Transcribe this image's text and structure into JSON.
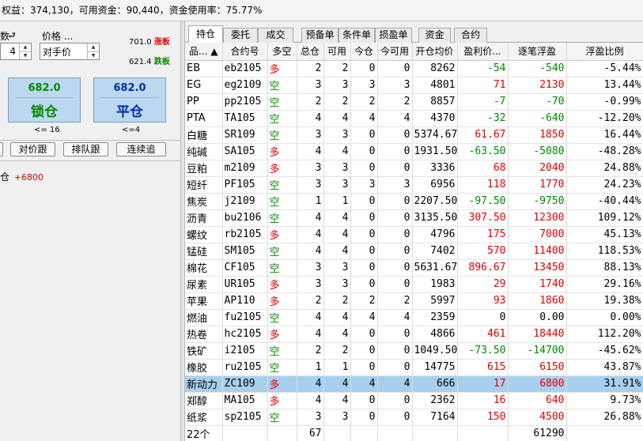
{
  "account_bar": {
    "text": "权益：374,130，可用资金：90,440，资金使用率：75.77%"
  },
  "order_panel": {
    "qty_label_fragment": "数",
    "qty_value": "4",
    "price_label": "价格 ...",
    "price_value": "对手价",
    "limit_up_value": "701.0",
    "limit_up_label": "涨板",
    "limit_down_value": "621.4",
    "limit_down_label": "跌板",
    "lock_button": {
      "price": "682.0",
      "label": "锁仓"
    },
    "close_button": {
      "price": "682.0",
      "label": "平仓"
    },
    "lock_qty_note": "<= 16",
    "close_qty_note": "<=4",
    "buttons": [
      "对价跟",
      "排队跟",
      "连续追"
    ],
    "status_prefix": "多仓",
    "status_value": "+6800"
  },
  "tabs": [
    "持仓",
    "委托",
    "成交",
    "预备单",
    "条件单",
    "损盈单",
    "资金",
    "合约"
  ],
  "active_tab": "持仓",
  "columns": [
    "品... ▲",
    "合约号",
    "多空",
    "总仓",
    "可用",
    "今仓",
    "今可用",
    "开仓均价",
    "盈利价...",
    "逐笔浮盈",
    "浮盈比例"
  ],
  "rows": [
    {
      "name": "EB",
      "code": "eb2105",
      "dir": "多",
      "total": "2",
      "avail": "2",
      "today": "0",
      "today_avail": "0",
      "avg": "8262",
      "pnl_price": "-54",
      "float_pnl": "-540",
      "ratio": "-5.44%"
    },
    {
      "name": "EG",
      "code": "eg2109",
      "dir": "空",
      "total": "3",
      "avail": "3",
      "today": "3",
      "today_avail": "3",
      "avg": "4801",
      "pnl_price": "71",
      "float_pnl": "2130",
      "ratio": "13.44%"
    },
    {
      "name": "PP",
      "code": "pp2105",
      "dir": "空",
      "total": "2",
      "avail": "2",
      "today": "2",
      "today_avail": "2",
      "avg": "8857",
      "pnl_price": "-7",
      "float_pnl": "-70",
      "ratio": "-0.99%"
    },
    {
      "name": "PTA",
      "code": "TA105",
      "dir": "空",
      "total": "4",
      "avail": "4",
      "today": "4",
      "today_avail": "4",
      "avg": "4370",
      "pnl_price": "-32",
      "float_pnl": "-640",
      "ratio": "-12.20%"
    },
    {
      "name": "白糖",
      "code": "SR109",
      "dir": "空",
      "total": "3",
      "avail": "3",
      "today": "0",
      "today_avail": "0",
      "avg": "5374.67",
      "pnl_price": "61.67",
      "float_pnl": "1850",
      "ratio": "16.44%"
    },
    {
      "name": "纯碱",
      "code": "SA105",
      "dir": "多",
      "total": "4",
      "avail": "4",
      "today": "0",
      "today_avail": "0",
      "avg": "1931.50",
      "pnl_price": "-63.50",
      "float_pnl": "-5080",
      "ratio": "-48.28%"
    },
    {
      "name": "豆粕",
      "code": "m2109",
      "dir": "多",
      "total": "3",
      "avail": "3",
      "today": "0",
      "today_avail": "0",
      "avg": "3336",
      "pnl_price": "68",
      "float_pnl": "2040",
      "ratio": "24.88%"
    },
    {
      "name": "短纤",
      "code": "PF105",
      "dir": "空",
      "total": "3",
      "avail": "3",
      "today": "3",
      "today_avail": "3",
      "avg": "6956",
      "pnl_price": "118",
      "float_pnl": "1770",
      "ratio": "24.23%"
    },
    {
      "name": "焦炭",
      "code": "j2109",
      "dir": "空",
      "total": "1",
      "avail": "1",
      "today": "0",
      "today_avail": "0",
      "avg": "2207.50",
      "pnl_price": "-97.50",
      "float_pnl": "-9750",
      "ratio": "-40.44%"
    },
    {
      "name": "沥青",
      "code": "bu2106",
      "dir": "空",
      "total": "4",
      "avail": "4",
      "today": "0",
      "today_avail": "0",
      "avg": "3135.50",
      "pnl_price": "307.50",
      "float_pnl": "12300",
      "ratio": "109.12%"
    },
    {
      "name": "螺纹",
      "code": "rb2105",
      "dir": "多",
      "total": "4",
      "avail": "4",
      "today": "0",
      "today_avail": "0",
      "avg": "4796",
      "pnl_price": "175",
      "float_pnl": "7000",
      "ratio": "45.13%"
    },
    {
      "name": "锰硅",
      "code": "SM105",
      "dir": "空",
      "total": "4",
      "avail": "4",
      "today": "0",
      "today_avail": "0",
      "avg": "7402",
      "pnl_price": "570",
      "float_pnl": "11400",
      "ratio": "118.53%"
    },
    {
      "name": "棉花",
      "code": "CF105",
      "dir": "空",
      "total": "3",
      "avail": "3",
      "today": "0",
      "today_avail": "0",
      "avg": "5631.67",
      "pnl_price": "896.67",
      "float_pnl": "13450",
      "ratio": "88.13%"
    },
    {
      "name": "尿素",
      "code": "UR105",
      "dir": "多",
      "total": "3",
      "avail": "3",
      "today": "0",
      "today_avail": "0",
      "avg": "1983",
      "pnl_price": "29",
      "float_pnl": "1740",
      "ratio": "29.16%"
    },
    {
      "name": "苹果",
      "code": "AP110",
      "dir": "多",
      "total": "2",
      "avail": "2",
      "today": "2",
      "today_avail": "2",
      "avg": "5997",
      "pnl_price": "93",
      "float_pnl": "1860",
      "ratio": "19.38%"
    },
    {
      "name": "燃油",
      "code": "fu2105",
      "dir": "空",
      "total": "4",
      "avail": "4",
      "today": "4",
      "today_avail": "4",
      "avg": "2359",
      "pnl_price": "0",
      "float_pnl": "0.00",
      "ratio": "0.00%"
    },
    {
      "name": "热卷",
      "code": "hc2105",
      "dir": "多",
      "total": "4",
      "avail": "4",
      "today": "0",
      "today_avail": "0",
      "avg": "4866",
      "pnl_price": "461",
      "float_pnl": "18440",
      "ratio": "112.20%"
    },
    {
      "name": "铁矿",
      "code": "i2105",
      "dir": "空",
      "total": "2",
      "avail": "2",
      "today": "0",
      "today_avail": "0",
      "avg": "1049.50",
      "pnl_price": "-73.50",
      "float_pnl": "-14700",
      "ratio": "-45.62%"
    },
    {
      "name": "橡胶",
      "code": "ru2105",
      "dir": "空",
      "total": "1",
      "avail": "1",
      "today": "0",
      "today_avail": "0",
      "avg": "14775",
      "pnl_price": "615",
      "float_pnl": "6150",
      "ratio": "43.87%"
    },
    {
      "name": "新动力",
      "code": "ZC109",
      "dir": "多",
      "total": "4",
      "avail": "4",
      "today": "4",
      "today_avail": "4",
      "avg": "666",
      "pnl_price": "17",
      "float_pnl": "6800",
      "ratio": "31.91%"
    },
    {
      "name": "郑醇",
      "code": "MA105",
      "dir": "多",
      "total": "4",
      "avail": "4",
      "today": "0",
      "today_avail": "0",
      "avg": "2362",
      "pnl_price": "16",
      "float_pnl": "640",
      "ratio": "9.73%"
    },
    {
      "name": "纸浆",
      "code": "sp2105",
      "dir": "空",
      "total": "3",
      "avail": "3",
      "today": "0",
      "today_avail": "0",
      "avg": "7164",
      "pnl_price": "150",
      "float_pnl": "4500",
      "ratio": "26.88%"
    }
  ],
  "selected_row": 19,
  "summary": {
    "count": "22个",
    "total": "67",
    "float_pnl": "61290"
  },
  "colors": {
    "long": "#e00000",
    "short": "#008800",
    "selected": "#a8d0ee",
    "button": "#bcd8f0"
  }
}
